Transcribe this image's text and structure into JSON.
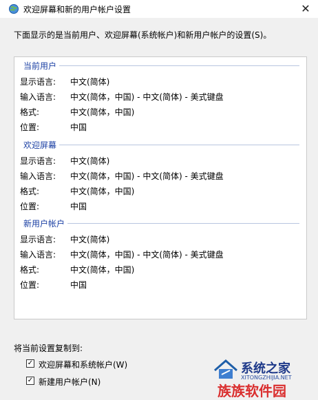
{
  "window": {
    "title": "欢迎屏幕和新的用户帐户设置",
    "close_glyph": "✕"
  },
  "description": "下面显示的是当前用户、欢迎屏幕(系统帐户)和新用户帐户的设置(S)。",
  "sections": [
    {
      "title": "当前用户",
      "rows": [
        {
          "label": "显示语言:",
          "value": "中文(简体)"
        },
        {
          "label": "输入语言:",
          "value": "中文(简体，中国) - 中文(简体) - 美式键盘"
        },
        {
          "label": "格式:",
          "value": "中文(简体，中国)"
        },
        {
          "label": "位置:",
          "value": "中国"
        }
      ]
    },
    {
      "title": "欢迎屏幕",
      "rows": [
        {
          "label": "显示语言:",
          "value": "中文(简体)"
        },
        {
          "label": "输入语言:",
          "value": "中文(简体，中国) - 中文(简体) - 美式键盘"
        },
        {
          "label": "格式:",
          "value": "中文(简体，中国)"
        },
        {
          "label": "位置:",
          "value": "中国"
        }
      ]
    },
    {
      "title": "新用户帐户",
      "rows": [
        {
          "label": "显示语言:",
          "value": "中文(简体)"
        },
        {
          "label": "输入语言:",
          "value": "中文(简体，中国) - 中文(简体) - 美式键盘"
        },
        {
          "label": "格式:",
          "value": "中文(简体，中国)"
        },
        {
          "label": "位置:",
          "value": "中国"
        }
      ]
    }
  ],
  "copy": {
    "label": "将当前设置复制到:",
    "options": [
      {
        "label": "欢迎屏幕和系统帐户(W)",
        "checked": true
      },
      {
        "label": "新建用户帐户(N)",
        "checked": true
      }
    ]
  },
  "watermark": {
    "main": "系统之家",
    "sub": "XITONGZHIJIA.NET",
    "red": "族族软件园"
  }
}
